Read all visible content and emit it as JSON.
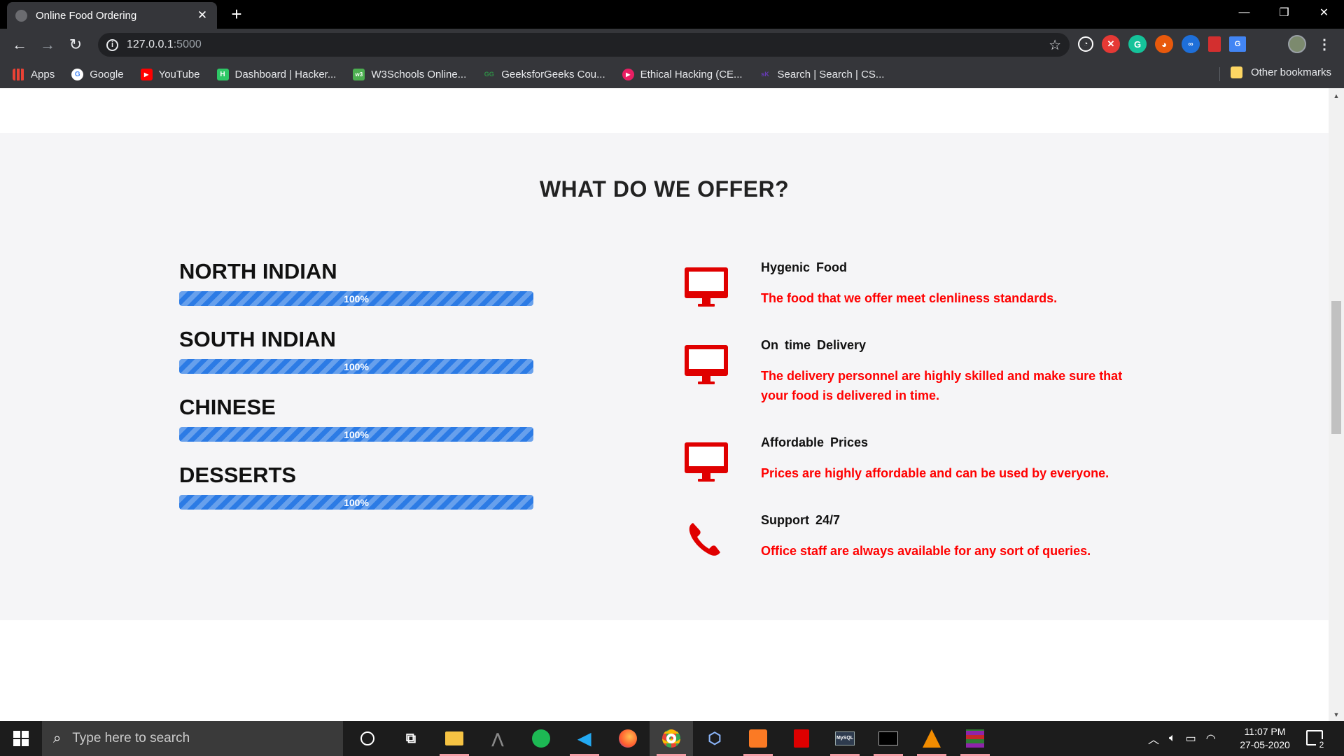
{
  "browser": {
    "tab_title": "Online Food Ordering",
    "tab_close": "✕",
    "new_tab": "+",
    "url_host": "127.0.0.1",
    "url_port": ":5000",
    "minimize": "—",
    "restore": "❐",
    "close": "✕"
  },
  "bookmarks": [
    {
      "label": "Apps",
      "icon": "apps-grid-icon",
      "color": "#e94235"
    },
    {
      "label": "Google",
      "icon": "google-icon",
      "color": "#ffffff"
    },
    {
      "label": "YouTube",
      "icon": "youtube-icon",
      "color": "#ff0000"
    },
    {
      "label": "Dashboard | Hacker...",
      "icon": "hackerrank-icon",
      "color": "#2ec866"
    },
    {
      "label": "W3Schools Online...",
      "icon": "w3schools-icon",
      "color": "#4caf50"
    },
    {
      "label": "GeeksforGeeks Cou...",
      "icon": "geeksforgeeks-icon",
      "color": "#2f8d46"
    },
    {
      "label": "Ethical Hacking (CE...",
      "icon": "ethical-hacking-icon",
      "color": "#e91e63"
    },
    {
      "label": "Search | Search | CS...",
      "icon": "cs-search-icon",
      "color": "#673ab7"
    }
  ],
  "other_bookmarks": "Other bookmarks",
  "page": {
    "section_title": "WHAT DO WE OFFER?",
    "skills": [
      {
        "name": "NORTH INDIAN",
        "percent_label": "100%",
        "percent": 100
      },
      {
        "name": "SOUTH INDIAN",
        "percent_label": "100%",
        "percent": 100
      },
      {
        "name": "CHINESE",
        "percent_label": "100%",
        "percent": 100
      },
      {
        "name": "DESSERTS",
        "percent_label": "100%",
        "percent": 100
      }
    ],
    "features": [
      {
        "title": "Hygenic Food",
        "desc": "The food that we offer meet clenliness standards.",
        "icon": "desktop-icon"
      },
      {
        "title": "On time Delivery",
        "desc": "The delivery personnel are highly skilled and make sure that your food is delivered in time.",
        "icon": "desktop-icon"
      },
      {
        "title": "Affordable Prices",
        "desc": "Prices are highly affordable and can be used by everyone.",
        "icon": "desktop-icon"
      },
      {
        "title": "Support 24/7",
        "desc": "Office staff are always available for any sort of queries.",
        "icon": "phone-icon"
      }
    ],
    "accent_color": "#ff0000",
    "progress_color": "#2c7be5"
  },
  "taskbar": {
    "search_placeholder": "Type here to search",
    "time": "11:07 PM",
    "date": "27-05-2020",
    "notification_count": "2"
  }
}
